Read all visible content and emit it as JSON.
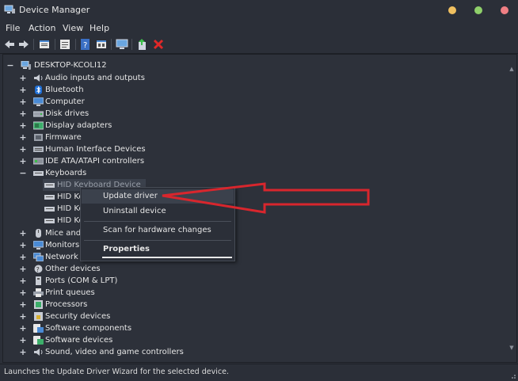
{
  "window": {
    "title": "Device Manager"
  },
  "window_controls": {
    "colors": [
      "#f0c060",
      "#8fd06a",
      "#f07f84"
    ]
  },
  "menu": [
    "File",
    "Action",
    "View",
    "Help"
  ],
  "toolbar_icons": [
    "back-arrow-icon",
    "forward-arrow-icon",
    "properties-icon",
    "details-icon",
    "help-icon",
    "view-icon",
    "monitor-icon",
    "update-driver-icon",
    "uninstall-icon"
  ],
  "tree": {
    "root": "DESKTOP-KCOLI12",
    "categories": [
      "Audio inputs and outputs",
      "Bluetooth",
      "Computer",
      "Disk drives",
      "Display adapters",
      "Firmware",
      "Human Interface Devices",
      "IDE ATA/ATAPI controllers",
      "Keyboards",
      "HID Keyboard Device",
      "HID Ke",
      "HID Ke",
      "HID Ke",
      "Mice and",
      "Monitors",
      "Network adapters",
      "Other devices",
      "Ports (COM & LPT)",
      "Print queues",
      "Processors",
      "Security devices",
      "Software components",
      "Software devices",
      "Sound, video and game controllers"
    ]
  },
  "context_menu": {
    "update_driver": "Update driver",
    "uninstall_device": "Uninstall device",
    "scan": "Scan for hardware changes",
    "properties": "Properties"
  },
  "status": "Launches the Update Driver Wizard for the selected device.",
  "accent": {
    "arrow": "#d8262d",
    "highlight": "#3b414c"
  }
}
